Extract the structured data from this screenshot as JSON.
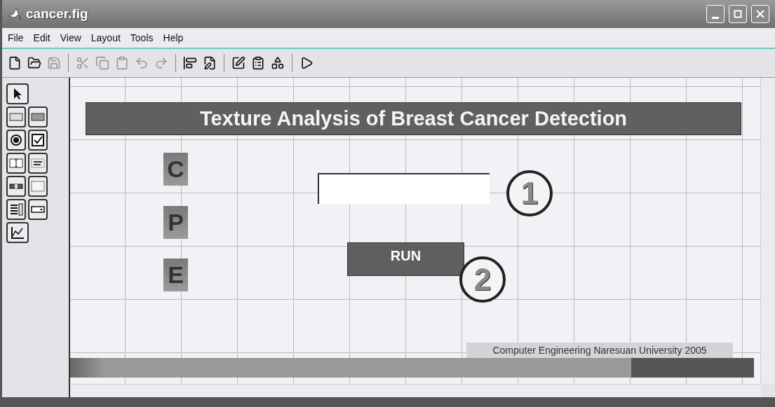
{
  "window": {
    "title": "cancer.fig"
  },
  "menu": [
    {
      "label": "File"
    },
    {
      "label": "Edit"
    },
    {
      "label": "View"
    },
    {
      "label": "Layout"
    },
    {
      "label": "Tools"
    },
    {
      "label": "Help"
    }
  ],
  "toolbar_groups": [
    [
      {
        "kind": "new",
        "disabled": false
      },
      {
        "kind": "open",
        "disabled": false
      },
      {
        "kind": "save",
        "disabled": true
      }
    ],
    [
      {
        "kind": "cut",
        "disabled": true
      },
      {
        "kind": "copy",
        "disabled": true
      },
      {
        "kind": "paste",
        "disabled": true
      },
      {
        "kind": "undo",
        "disabled": true
      },
      {
        "kind": "redo",
        "disabled": true
      }
    ],
    [
      {
        "kind": "align",
        "disabled": false
      },
      {
        "kind": "menu_editor",
        "disabled": false
      }
    ],
    [
      {
        "kind": "editor",
        "disabled": false
      },
      {
        "kind": "inspector",
        "disabled": false
      },
      {
        "kind": "browser",
        "disabled": false
      }
    ],
    [
      {
        "kind": "run",
        "disabled": false
      }
    ]
  ],
  "palette": [
    {
      "kind": "pointer"
    },
    {
      "kind": "push_button"
    },
    {
      "kind": "toggle_button"
    },
    {
      "kind": "radio"
    },
    {
      "kind": "checkbox"
    },
    {
      "kind": "edit_text"
    },
    {
      "kind": "static_text"
    },
    {
      "kind": "slider"
    },
    {
      "kind": "frame"
    },
    {
      "kind": "listbox"
    },
    {
      "kind": "popup"
    },
    {
      "kind": "axes"
    }
  ],
  "figure": {
    "banner": "Texture Analysis of Breast Cancer Detection",
    "tiles": [
      "C",
      "P",
      "E"
    ],
    "run_button": "RUN",
    "footer": "Computer Engineering Naresuan University 2005",
    "callouts": [
      "1",
      "2"
    ]
  }
}
